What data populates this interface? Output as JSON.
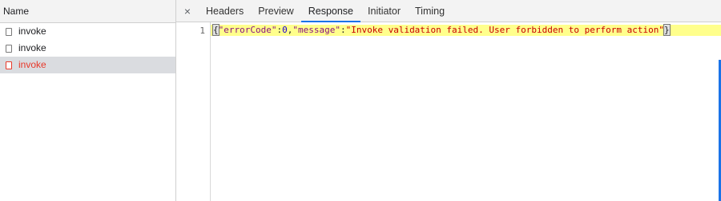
{
  "requests_panel": {
    "column_header": "Name",
    "items": [
      {
        "label": "invoke",
        "state": "normal"
      },
      {
        "label": "invoke",
        "state": "normal"
      },
      {
        "label": "invoke",
        "state": "error-selected"
      }
    ]
  },
  "details_panel": {
    "close_symbol": "×",
    "tabs": [
      {
        "label": "Headers"
      },
      {
        "label": "Preview"
      },
      {
        "label": "Response",
        "active": true
      },
      {
        "label": "Initiator"
      },
      {
        "label": "Timing"
      }
    ],
    "response": {
      "line_number": "1",
      "tokens": {
        "open_brace": "{",
        "key1": "\"errorCode\"",
        "colon1": ":",
        "value1": "0",
        "comma": ",",
        "key2": "\"message\"",
        "colon2": ":",
        "value2": "\"Invoke validation failed. User forbidden to perform action\"",
        "close_brace": "}"
      }
    }
  },
  "colors": {
    "active_tab_underline": "#1a73e8",
    "error_text": "#e8392a",
    "highlight_line": "#ffff8c",
    "json_key": "#881280",
    "json_string": "#c80000",
    "json_number": "#1c00cf"
  }
}
